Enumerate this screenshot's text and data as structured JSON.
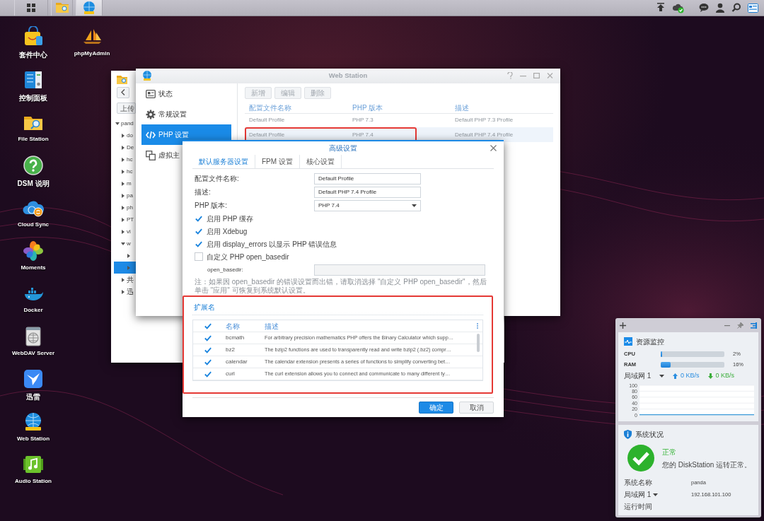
{
  "taskbar": {
    "buttons": [
      {
        "kind": "apps",
        "selected": false
      },
      {
        "kind": "files",
        "selected": false
      },
      {
        "kind": "globe",
        "selected": true
      }
    ]
  },
  "desktop_icons": [
    {
      "label": "套件中心",
      "kind": "package"
    },
    {
      "label": "控制面板",
      "kind": "control"
    },
    {
      "label": "File Station",
      "kind": "folder"
    },
    {
      "label": "DSM 说明",
      "kind": "help"
    },
    {
      "label": "Cloud Sync",
      "kind": "cloud"
    },
    {
      "label": "Moments",
      "kind": "flower"
    },
    {
      "label": "Docker",
      "kind": "whale"
    },
    {
      "label": "WebDAV Server",
      "kind": "server"
    },
    {
      "label": "迅雷",
      "kind": "bird"
    },
    {
      "label": "Web Station",
      "kind": "globe"
    },
    {
      "label": "Audio Station",
      "kind": "music"
    },
    {
      "label": "phpMyAdmin",
      "kind": "sail"
    }
  ],
  "file_station": {
    "upload_button": "上传",
    "tree": [
      {
        "label": "pand",
        "expanded": true,
        "selected": false,
        "children": [
          {
            "label": "do",
            "expanded": false,
            "selected": false
          },
          {
            "label": "De",
            "expanded": false,
            "selected": false
          },
          {
            "label": "hc",
            "expanded": false,
            "selected": false
          },
          {
            "label": "hc",
            "expanded": false,
            "selected": false
          },
          {
            "label": "m",
            "expanded": false,
            "selected": false
          },
          {
            "label": "pa",
            "expanded": false,
            "selected": false
          },
          {
            "label": "ph",
            "expanded": false,
            "selected": false
          },
          {
            "label": "PT",
            "expanded": false,
            "selected": false
          },
          {
            "label": "vi",
            "expanded": false,
            "selected": false
          },
          {
            "label": "w",
            "expanded": true,
            "selected": false,
            "children": [
              {
                "expanded": false,
                "selected": false
              },
              {
                "expanded": false,
                "selected": true
              }
            ]
          },
          {
            "label": "共",
            "expanded": false,
            "selected": false
          },
          {
            "label": "迅",
            "expanded": false,
            "selected": false
          }
        ]
      }
    ]
  },
  "web_station": {
    "title": "Web Station",
    "sidebar": [
      {
        "label": "状态",
        "kind": "status",
        "selected": false
      },
      {
        "label": "常规设置",
        "kind": "gear",
        "selected": false
      },
      {
        "label": "PHP 设置",
        "kind": "code",
        "selected": true
      },
      {
        "label": "虚拟主",
        "kind": "hosts",
        "selected": false
      }
    ],
    "toolbar": [
      {
        "label": "新增",
        "disabled": true
      },
      {
        "label": "编辑",
        "disabled": true
      },
      {
        "label": "删除",
        "disabled": true
      }
    ],
    "table": {
      "columns": [
        "配置文件名称",
        "PHP 版本",
        "描述"
      ],
      "rows": [
        {
          "cells": [
            "Default Profile",
            "PHP 7.3",
            "Default PHP 7.3 Profile"
          ],
          "selected": false,
          "outlined": false
        },
        {
          "cells": [
            "Default Profile",
            "PHP 7.4",
            "Default PHP 7.4 Profile"
          ],
          "selected": true,
          "outlined": true
        }
      ]
    }
  },
  "dialog": {
    "title": "高级设置",
    "tabs": [
      {
        "label": "默认服务器设置",
        "selected": true
      },
      {
        "label": "FPM 设置",
        "selected": false
      },
      {
        "label": "核心设置",
        "selected": false
      }
    ],
    "fields": [
      {
        "label": "配置文件名称:",
        "value": "Default Profile",
        "kind": "text"
      },
      {
        "label": "描述:",
        "value": "Default PHP 7.4 Profile",
        "kind": "text"
      },
      {
        "label": "PHP 版本:",
        "value": "PHP 7.4",
        "kind": "select"
      }
    ],
    "options": [
      {
        "label": "启用 PHP 缓存",
        "checked": true
      },
      {
        "label": "启用 Xdebug",
        "checked": true
      },
      {
        "label": "启用 display_errors 以显示 PHP 错误信息",
        "checked": true
      },
      {
        "label": "自定义 PHP open_basedir",
        "checked": false
      }
    ],
    "basedir": {
      "label": "open_basedir:",
      "disabled": true
    },
    "note": "注：如果因 open_basedir 的错误设置而出错，请取消选择 \"自定义 PHP open_basedir\"，然后单击 \"应用\" 可恢复到系统默认设置。",
    "extensions": {
      "title": "扩展名",
      "outlined": true,
      "all_checked": true,
      "columns": [
        "名称",
        "描述"
      ],
      "rows": [
        {
          "name": "bcmath",
          "description": "For arbitrary precision mathematics PHP offers the Binary Calculator which supp…",
          "checked": true
        },
        {
          "name": "bz2",
          "description": "The bzip2 functions are used to transparently read and write bzip2 (.bz2) compr…",
          "checked": true
        },
        {
          "name": "calendar",
          "description": "The calendar extension presents a series of functions to simplify converting bet…",
          "checked": true
        },
        {
          "name": "curl",
          "description": "The curl extension allows you to connect and communicate to many different ty…",
          "checked": true
        }
      ]
    },
    "buttons": [
      {
        "label": "确定",
        "kind": "primary"
      },
      {
        "label": "取消",
        "kind": "secondary"
      }
    ]
  },
  "widgets": {
    "resource_monitor": {
      "title": "资源监控",
      "meters": [
        {
          "label": "CPU",
          "level": 0.02,
          "reading": "2%"
        },
        {
          "label": "RAM",
          "level": 0.16,
          "reading": "16%"
        }
      ],
      "network": {
        "label": "局域网 1",
        "upload": "0 KB/s",
        "download": "0 KB/s"
      },
      "chart_data": {
        "type": "line",
        "grid": true,
        "ylim": [
          0,
          100
        ],
        "yticks": [
          0,
          20,
          40,
          60,
          80,
          100
        ],
        "series": [
          {
            "color": "#3a9ad9",
            "values": [
              1,
              1,
              1,
              1,
              1,
              1,
              1,
              1,
              1,
              1,
              1,
              1
            ]
          }
        ]
      }
    },
    "system_status": {
      "title": "系统状况",
      "status": "正常",
      "message": "您的 DiskStation 运转正常。",
      "rows": [
        {
          "label": "系统名称",
          "value": "panda",
          "dropdown": false
        },
        {
          "label": "局域网 1",
          "value": "192.168.101.100",
          "dropdown": true
        },
        {
          "label": "运行时间",
          "dropdown": false
        }
      ]
    }
  }
}
